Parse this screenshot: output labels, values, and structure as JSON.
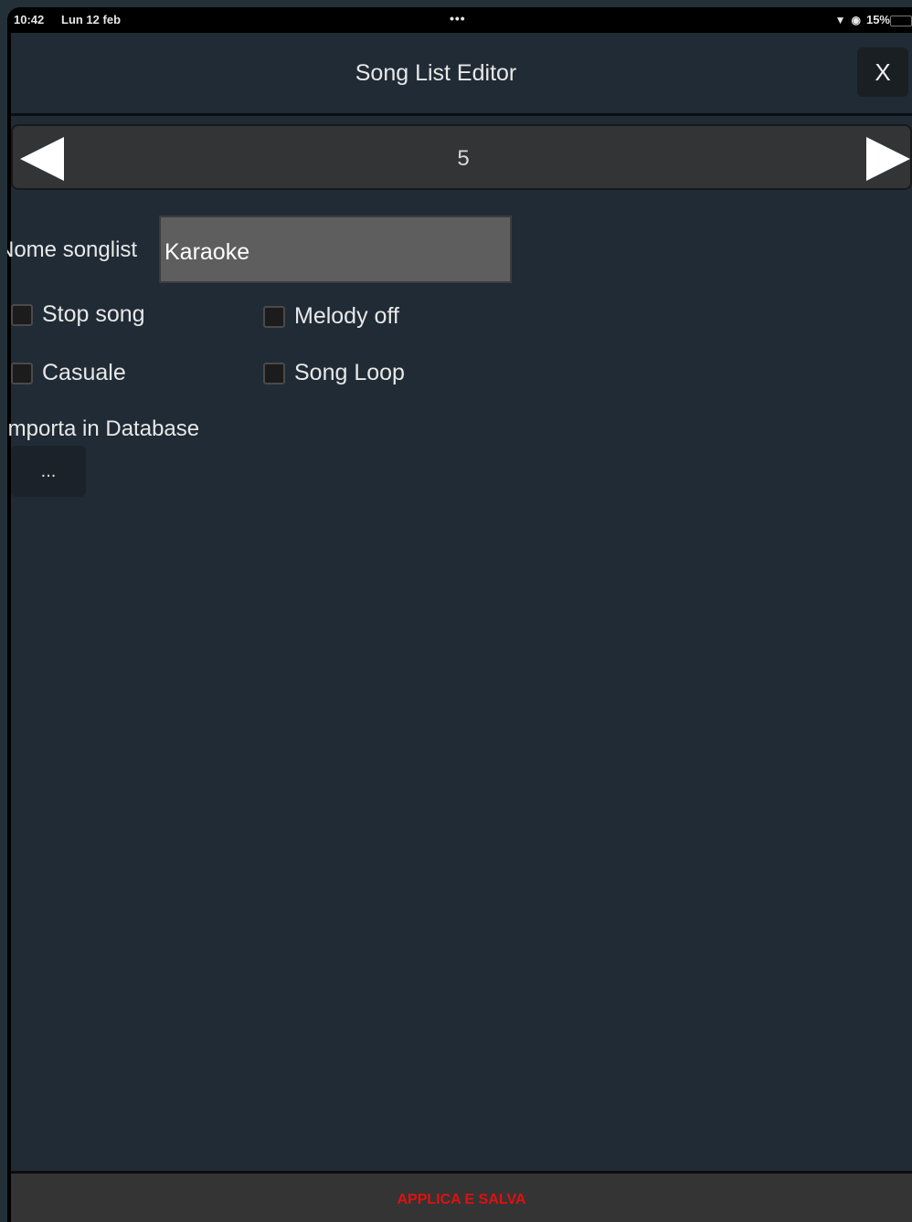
{
  "status_bar": {
    "time": "10:42",
    "date": "Lun 12 feb",
    "dots": "•••",
    "battery": "15%"
  },
  "header": {
    "title": "Song List Editor",
    "close_label": "X"
  },
  "navigator": {
    "current": "5"
  },
  "form": {
    "name_label": "Nome songlist",
    "name_value": "Karaoke",
    "checkboxes": [
      {
        "label": "Stop song",
        "checked": false
      },
      {
        "label": "Melody off",
        "checked": false
      },
      {
        "label": "Casuale",
        "checked": false
      },
      {
        "label": "Song Loop",
        "checked": false
      }
    ],
    "import_label": "Importa in Database",
    "import_button": "..."
  },
  "footer": {
    "apply_label": "APPLICA E SALVA"
  },
  "colors": {
    "background": "#202b35",
    "apply_text": "#e01010"
  }
}
